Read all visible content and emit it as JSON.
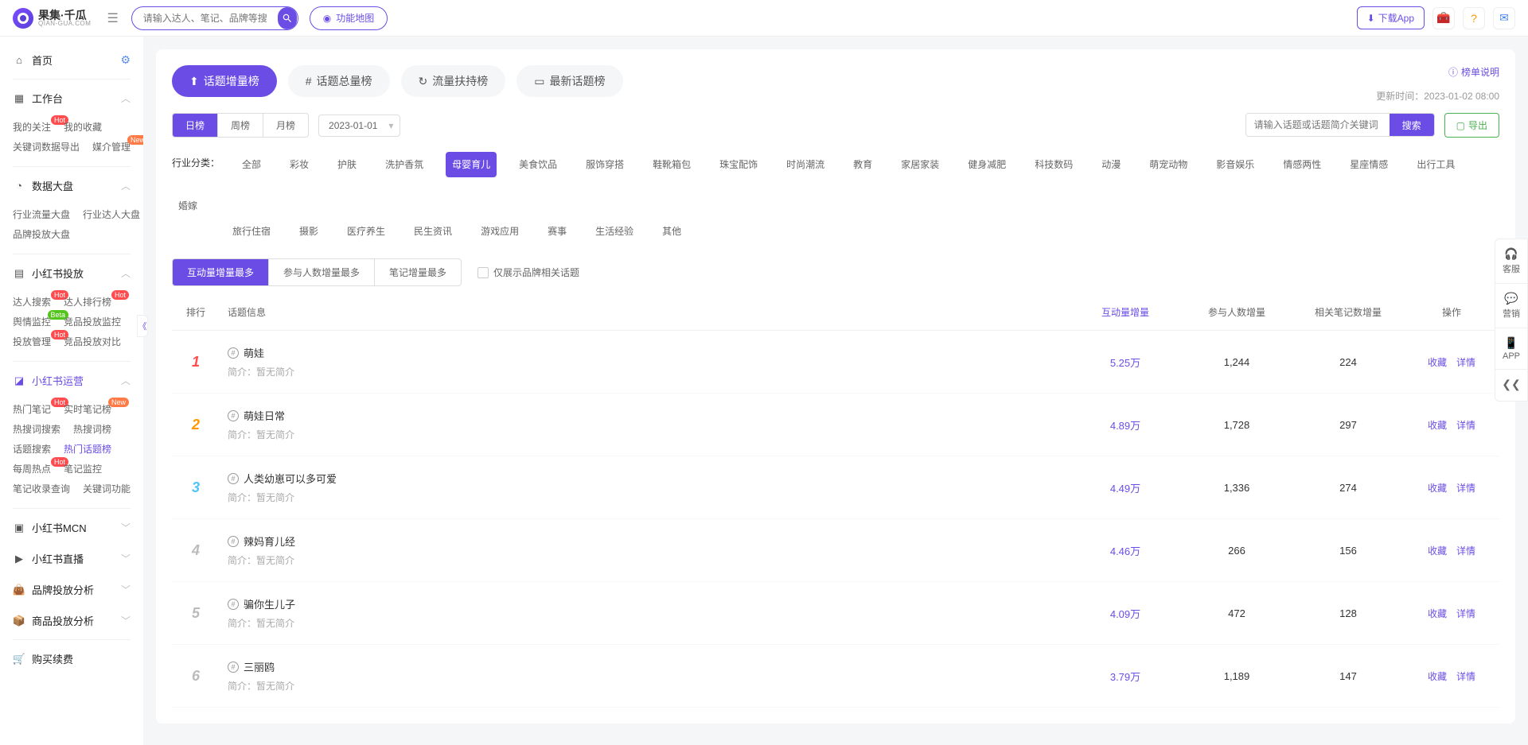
{
  "logo": {
    "main": "果集·千瓜",
    "sub": "QIAN-GUA.COM"
  },
  "search": {
    "placeholder": "请输入达人、笔记、品牌等搜索"
  },
  "funcMap": "功能地图",
  "dlApp": "下载App",
  "sidebar": {
    "home": "首页",
    "workbench": "工作台",
    "workbenchSub": [
      [
        "我的关注",
        "Hot",
        "我的收藏",
        ""
      ],
      [
        "关键词数据导出",
        "",
        "媒介管理",
        "New"
      ]
    ],
    "dataOverview": "数据大盘",
    "dataSub": [
      [
        "行业流量大盘",
        "",
        "行业达人大盘",
        ""
      ],
      [
        "品牌投放大盘",
        "",
        "",
        ""
      ]
    ],
    "xhsPut": "小红书投放",
    "putSub": [
      [
        "达人搜索",
        "Hot",
        "达人排行榜",
        "Hot"
      ],
      [
        "舆情监控",
        "Beta",
        "竞品投放监控",
        ""
      ],
      [
        "投放管理",
        "Hot",
        "竞品投放对比",
        ""
      ]
    ],
    "xhsOp": "小红书运营",
    "opSub": [
      [
        "热门笔记",
        "Hot",
        "实时笔记榜",
        "New"
      ],
      [
        "热搜词搜索",
        "",
        "热搜词榜",
        ""
      ],
      [
        "话题搜索",
        "",
        "热门话题榜",
        ""
      ],
      [
        "每周热点",
        "Hot",
        "笔记监控",
        ""
      ],
      [
        "笔记收录查询",
        "",
        "关键词功能",
        ""
      ]
    ],
    "mcn": "小红书MCN",
    "live": "小红书直播",
    "brand": "品牌投放分析",
    "product": "商品投放分析",
    "renew": "购买续费"
  },
  "mainTabs": [
    {
      "label": "话题增量榜",
      "active": true
    },
    {
      "label": "话题总量榜",
      "active": false
    },
    {
      "label": "流量扶持榜",
      "active": false
    },
    {
      "label": "最新话题榜",
      "active": false
    }
  ],
  "helpLink": "榜单说明",
  "updateTime": "更新时间：2023-01-02 08:00",
  "periods": [
    {
      "label": "日榜",
      "active": true
    },
    {
      "label": "周榜",
      "active": false
    },
    {
      "label": "月榜",
      "active": false
    }
  ],
  "date": "2023-01-01",
  "topicSearch": {
    "placeholder": "请输入话题或话题简介关键词",
    "btn": "搜索"
  },
  "export": "导出",
  "catLabel": "行业分类：",
  "categories1": [
    "全部",
    "彩妆",
    "护肤",
    "洗护香氛",
    "母婴育儿",
    "美食饮品",
    "服饰穿搭",
    "鞋靴箱包",
    "珠宝配饰",
    "时尚潮流",
    "教育",
    "家居家装",
    "健身减肥",
    "科技数码",
    "动漫",
    "萌宠动物",
    "影音娱乐",
    "情感两性",
    "星座情感",
    "出行工具",
    "婚嫁"
  ],
  "categories2": [
    "旅行住宿",
    "摄影",
    "医疗养生",
    "民生资讯",
    "游戏应用",
    "赛事",
    "生活经验",
    "其他"
  ],
  "activeCat": "母婴育儿",
  "sortTabs": [
    {
      "label": "互动量增量最多",
      "active": true
    },
    {
      "label": "参与人数增量最多",
      "active": false
    },
    {
      "label": "笔记增量最多",
      "active": false
    }
  ],
  "brandOnly": "仅展示品牌相关话题",
  "columns": {
    "rank": "排行",
    "info": "话题信息",
    "c1": "互动量增量",
    "c2": "参与人数增量",
    "c3": "相关笔记数增量",
    "op": "操作"
  },
  "descPrefix": "简介：",
  "noDesc": "暂无简介",
  "ops": {
    "fav": "收藏",
    "detail": "详情"
  },
  "rows": [
    {
      "rank": 1,
      "title": "萌娃",
      "c1": "5.25万",
      "c2": "1,244",
      "c3": "224"
    },
    {
      "rank": 2,
      "title": "萌娃日常",
      "c1": "4.89万",
      "c2": "1,728",
      "c3": "297"
    },
    {
      "rank": 3,
      "title": "人类幼崽可以多可爱",
      "c1": "4.49万",
      "c2": "1,336",
      "c3": "274"
    },
    {
      "rank": 4,
      "title": "辣妈育儿经",
      "c1": "4.46万",
      "c2": "266",
      "c3": "156"
    },
    {
      "rank": 5,
      "title": "骗你生儿子",
      "c1": "4.09万",
      "c2": "472",
      "c3": "128"
    },
    {
      "rank": 6,
      "title": "三丽鸥",
      "c1": "3.79万",
      "c2": "1,189",
      "c3": "147"
    }
  ],
  "dock": [
    {
      "icon": "🎧",
      "label": "客服"
    },
    {
      "icon": "💬",
      "label": "营销"
    },
    {
      "icon": "📱",
      "label": "APP"
    },
    {
      "icon": "❮❮",
      "label": ""
    }
  ]
}
